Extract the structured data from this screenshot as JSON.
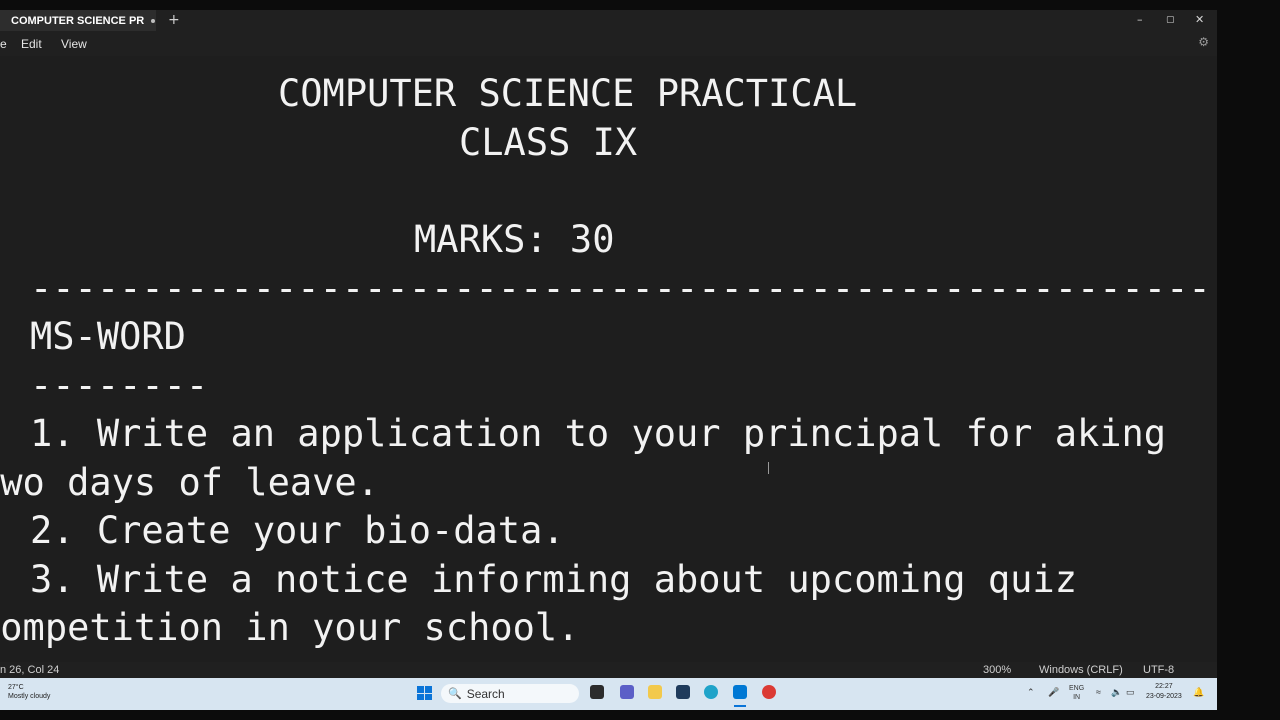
{
  "window": {
    "tab_title": "COMPUTER SCIENCE PR",
    "new_tab": "+",
    "controls": {
      "minimize": "–",
      "maximize": "▢",
      "close": "✕"
    }
  },
  "menu": {
    "file": "e",
    "edit": "Edit",
    "view": "View",
    "settings_icon": "gear-icon"
  },
  "document": {
    "lines": [
      "COMPUTER SCIENCE PRACTICAL",
      "CLASS IX",
      "MARKS: 30",
      "-----------------------------------------------------",
      "MS-WORD",
      "--------",
      "1. Write an application to your principal for aking",
      "two days of leave.",
      "2. Create your bio-data.",
      "3. Write a notice informing about upcoming quiz",
      "competition in your school."
    ]
  },
  "status": {
    "position": "n 26, Col 24",
    "zoom": "300%",
    "line_ending": "Windows (CRLF)",
    "encoding": "UTF-8"
  },
  "taskbar": {
    "weather_temp": "27°C",
    "weather_desc": "Mostly cloudy",
    "search_placeholder": "Search",
    "language": "ENG",
    "region": "IN",
    "time": "22:27",
    "date": "23-09-2023",
    "accent_color": "#0a74d8"
  }
}
